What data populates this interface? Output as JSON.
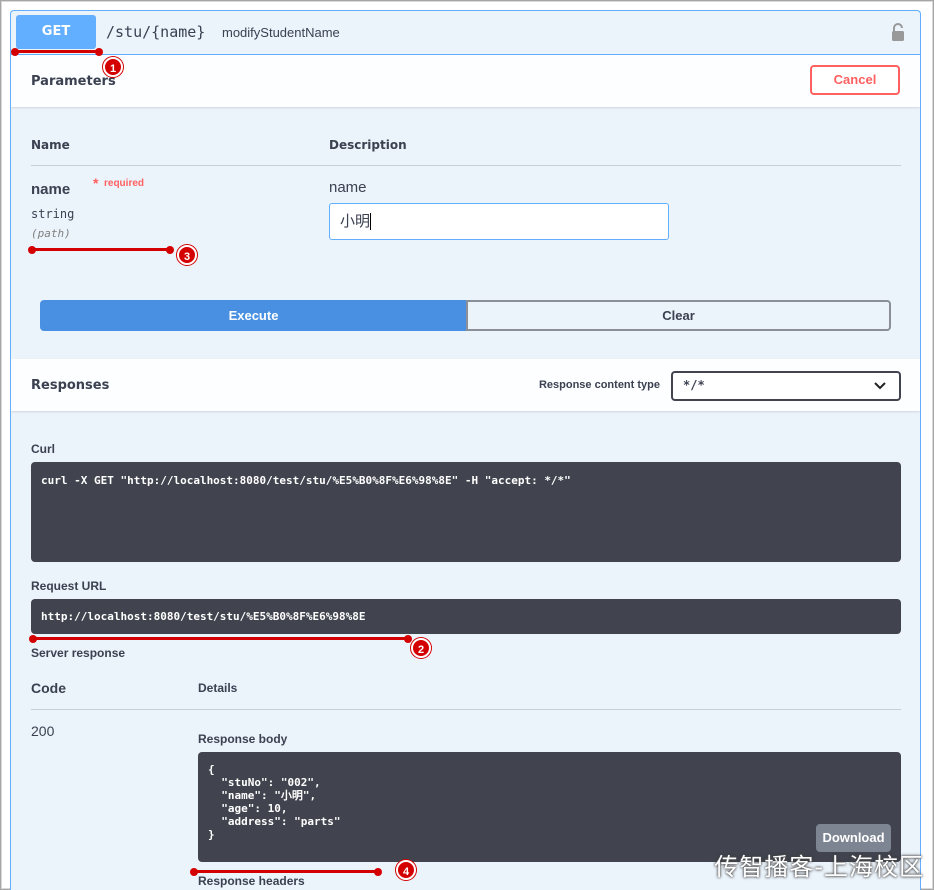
{
  "operation": {
    "method": "GET",
    "path": "/stu/{name}",
    "summary": "modifyStudentName"
  },
  "parameters": {
    "title": "Parameters",
    "cancel_label": "Cancel",
    "col_name": "Name",
    "col_description": "Description",
    "param_name": "name",
    "required_star": "*",
    "required_label": "required",
    "param_type": "string",
    "param_in": "(path)",
    "param_description": "name",
    "param_value": "小明"
  },
  "actions": {
    "execute_label": "Execute",
    "clear_label": "Clear"
  },
  "responses": {
    "title": "Responses",
    "content_type_label": "Response content type",
    "content_type_value": "*/*",
    "curl_label": "Curl",
    "curl": "curl -X GET \"http://localhost:8080/test/stu/%E5%B0%8F%E6%98%8E\" -H \"accept: */*\"",
    "request_url_label": "Request URL",
    "request_url": "http://localhost:8080/test/stu/%E5%B0%8F%E6%98%8E",
    "server_response_label": "Server response",
    "code_header": "Code",
    "details_header": "Details",
    "code": "200",
    "response_body_label": "Response body",
    "response_body": "{\n  \"stuNo\": \"002\",\n  \"name\": \"小明\",\n  \"age\": 10,\n  \"address\": \"parts\"\n}",
    "download_label": "Download",
    "response_headers_label": "Response headers"
  },
  "annotations": {
    "badge1": "1",
    "badge2": "2",
    "badge3": "3",
    "badge4": "4"
  },
  "watermark": "传智播客-上海校区",
  "colors": {
    "get_blue": "#61affe",
    "execute_blue": "#4990e2",
    "cancel_red": "#ff6060",
    "code_bg": "#41444e",
    "annotation_red": "#d40000"
  }
}
